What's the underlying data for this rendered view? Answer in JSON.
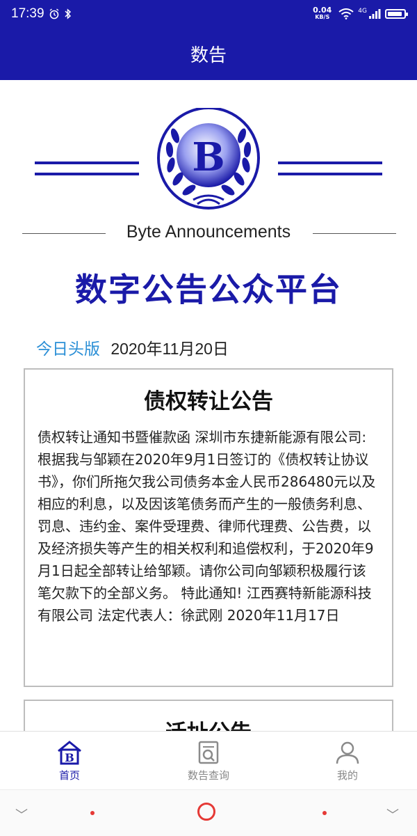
{
  "status_bar": {
    "time": "17:39",
    "speed_value": "0.04",
    "speed_unit": "KB/S",
    "network": "4G",
    "battery_level": 0.9
  },
  "app_bar": {
    "title": "数告"
  },
  "logo": {
    "letter": "B"
  },
  "subtitle": "Byte Announcements",
  "main_title": "数字公告公众平台",
  "date_row": {
    "label": "今日头版",
    "date": "2020年11月20日"
  },
  "cards": [
    {
      "title": "债权转让公告",
      "body": "债权转让通知书暨催款函 深圳市东捷新能源有限公司: 根据我与邹颖在2020年9月1日签订的《债权转让协议书》，你们所拖欠我公司债务本金人民币286480元以及相应的利息，以及因该笔债务而产生的一般债务利息、罚息、违约金、案件受理费、律师代理费、公告费，以及经济损失等产生的相关权利和追偿权利，于2020年9月1日起全部转让给邹颖。请你公司向邹颖积极履行该笔欠款下的全部义务。 特此通知! 江西赛特新能源科技有限公司 法定代表人：徐武刚 2020年11月17日"
    },
    {
      "title": "迁址公告",
      "body": ""
    }
  ],
  "tabs": [
    {
      "label": "首页",
      "icon": "home-icon",
      "active": true
    },
    {
      "label": "数告查询",
      "icon": "search-document-icon",
      "active": false
    },
    {
      "label": "我的",
      "icon": "user-icon",
      "active": false
    }
  ],
  "colors": {
    "brand": "#1a1aa8",
    "accent": "#2b8fd6",
    "nav_red": "#e53935"
  }
}
